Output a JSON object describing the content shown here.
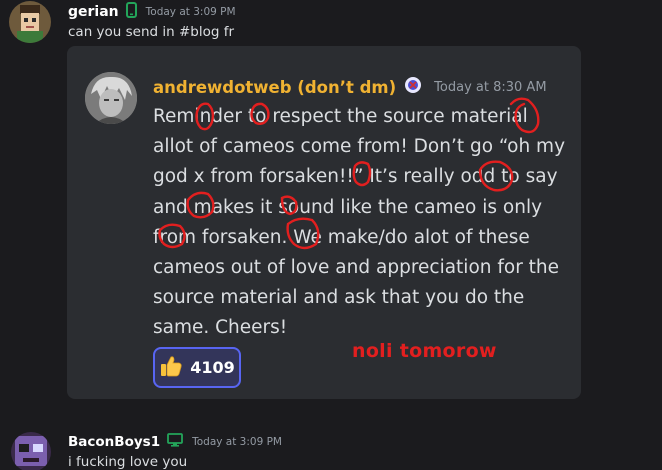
{
  "messages": [
    {
      "author": "gerian",
      "device": "mobile-icon",
      "timestamp": "Today at 3:09 PM",
      "text": "can you send in #blog fr"
    },
    {
      "author": "BaconBoys1",
      "device": "desktop-icon",
      "timestamp": "Today at 3:09 PM",
      "text": "i fucking love you"
    }
  ],
  "quoted": {
    "author": "andrewdotweb (don’t dm)",
    "timestamp": "Today at 8:30 AM",
    "body_lines": [
      "Reminder to respect the source material",
      "allot of cameos come from! Don’t go “oh my",
      "god x from forsaken!!” It’s really odd to say",
      "and makes it sound like the cameo is only",
      "from forsaken. We make/do alot of these",
      "cameos out of love and appreciation for the",
      "source material and ask that you do the",
      "same. Cheers!"
    ],
    "reaction": {
      "emoji": "thumbs-up",
      "count": "4109"
    }
  },
  "annotation": {
    "text": "noli tomorow",
    "color": "#e21f1f"
  },
  "colors": {
    "background": "#1b1b1e",
    "card": "#2b2d31",
    "quoted_author": "#f0b232",
    "reaction_border": "#5865f2",
    "status_green": "#23a55a"
  }
}
